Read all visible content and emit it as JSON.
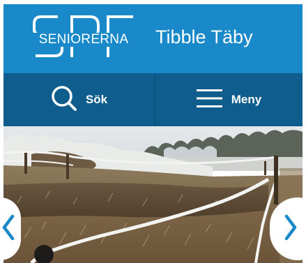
{
  "header": {
    "logo": {
      "letters": "SPF",
      "wordmark": "SENIORERNA"
    },
    "site_title": "Tibble Täby",
    "background_color": "#1a89c9"
  },
  "navbar": {
    "background_color": "#0f5d8d",
    "search": {
      "label": "Sök",
      "icon": "search-icon"
    },
    "menu": {
      "label": "Meny",
      "icon": "hamburger-icon"
    }
  },
  "carousel": {
    "image_subject": "frosty-field-with-fence",
    "prev_icon": "chevron-left-icon",
    "next_icon": "chevron-right-icon",
    "arrow_color": "#1a89c9"
  }
}
